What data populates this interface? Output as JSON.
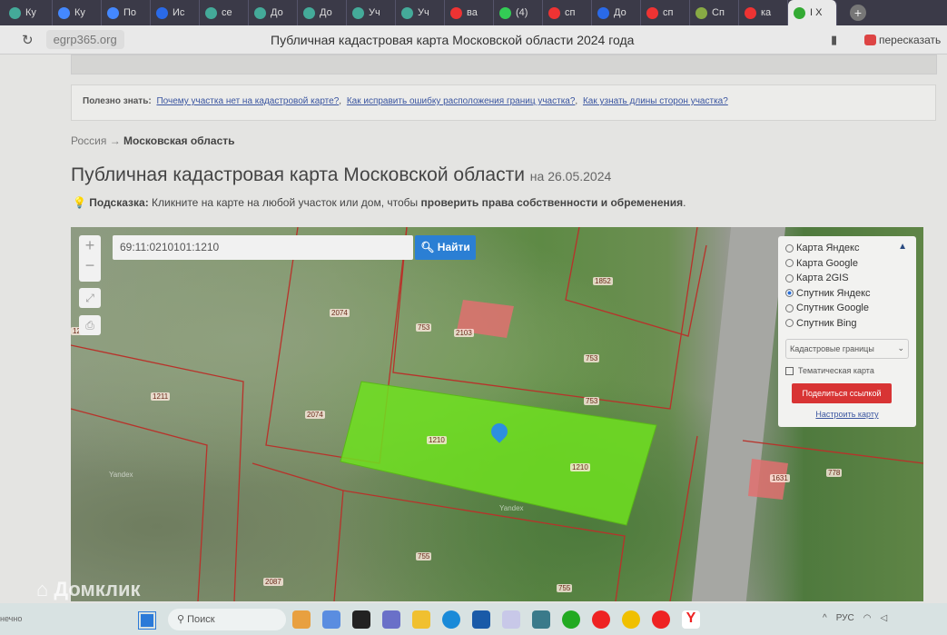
{
  "browser": {
    "tabs": [
      {
        "label": "Ку",
        "color": "#4a9"
      },
      {
        "label": "Ку",
        "color": "#48f"
      },
      {
        "label": "По",
        "color": "#48f"
      },
      {
        "label": "Ис",
        "color": "#2a6ae8"
      },
      {
        "label": "се",
        "color": "#4a9"
      },
      {
        "label": "До",
        "color": "#4a9"
      },
      {
        "label": "До",
        "color": "#4a9"
      },
      {
        "label": "Уч",
        "color": "#4a9"
      },
      {
        "label": "Уч",
        "color": "#4a9"
      },
      {
        "label": "ва",
        "color": "#e33"
      },
      {
        "label": "(4)",
        "color": "#3c5"
      },
      {
        "label": "сп",
        "color": "#e33"
      },
      {
        "label": "До",
        "color": "#2a6ae8"
      },
      {
        "label": "сп",
        "color": "#e33"
      },
      {
        "label": "Сп",
        "color": "#8a4"
      },
      {
        "label": "ка",
        "color": "#e33"
      },
      {
        "label": "I X",
        "color": "#3a3"
      }
    ],
    "new_tab": "+",
    "url": "egrp365.org",
    "page_title": "Публичная кадастровая карта Московской области 2024 года",
    "retell": "пересказать"
  },
  "info": {
    "label": "Полезно знать:",
    "links": [
      "Почему участка нет на кадастровой карте?",
      "Как исправить ошибку расположения границ участка?",
      "Как узнать длины сторон участка?"
    ]
  },
  "breadcrumb": {
    "root": "Россия",
    "arrow": "→",
    "current": "Московская область"
  },
  "heading": {
    "title": "Публичная кадастровая карта Московской области",
    "date": "на 26.05.2024"
  },
  "hint": {
    "label": "Подсказка:",
    "text": "Кликните на карте на любой участок или дом, чтобы",
    "bold": "проверить права собственности и обременения",
    "end": "."
  },
  "map": {
    "search_value": "69:11:0210101:1210",
    "find_label": "Найти",
    "zoom_in": "+",
    "zoom_out": "−",
    "layers": [
      {
        "label": "Карта Яндекс",
        "selected": false
      },
      {
        "label": "Карта Google",
        "selected": false
      },
      {
        "label": "Карта 2GIS",
        "selected": false
      },
      {
        "label": "Спутник Яндекс",
        "selected": true
      },
      {
        "label": "Спутник Google",
        "selected": false
      },
      {
        "label": "Спутник Bing",
        "selected": false
      }
    ],
    "overlay_select": "Кадастровые границы",
    "thematic_label": "Тематическая карта",
    "share_label": "Поделиться ссылкой",
    "configure_label": "Настроить карту",
    "parcel_labels": [
      "2074",
      "753",
      "2103",
      "1852",
      "1211",
      "753",
      "753",
      "2074",
      "1210",
      "1210",
      "1631",
      "778",
      "755",
      "755",
      "2087",
      "Yandex",
      "Yandex",
      "12"
    ],
    "selected_color": "#6fe020"
  },
  "watermark": "Домклик",
  "taskbar": {
    "left_text": "нечно",
    "search": "Поиск",
    "lang": "РУС"
  }
}
